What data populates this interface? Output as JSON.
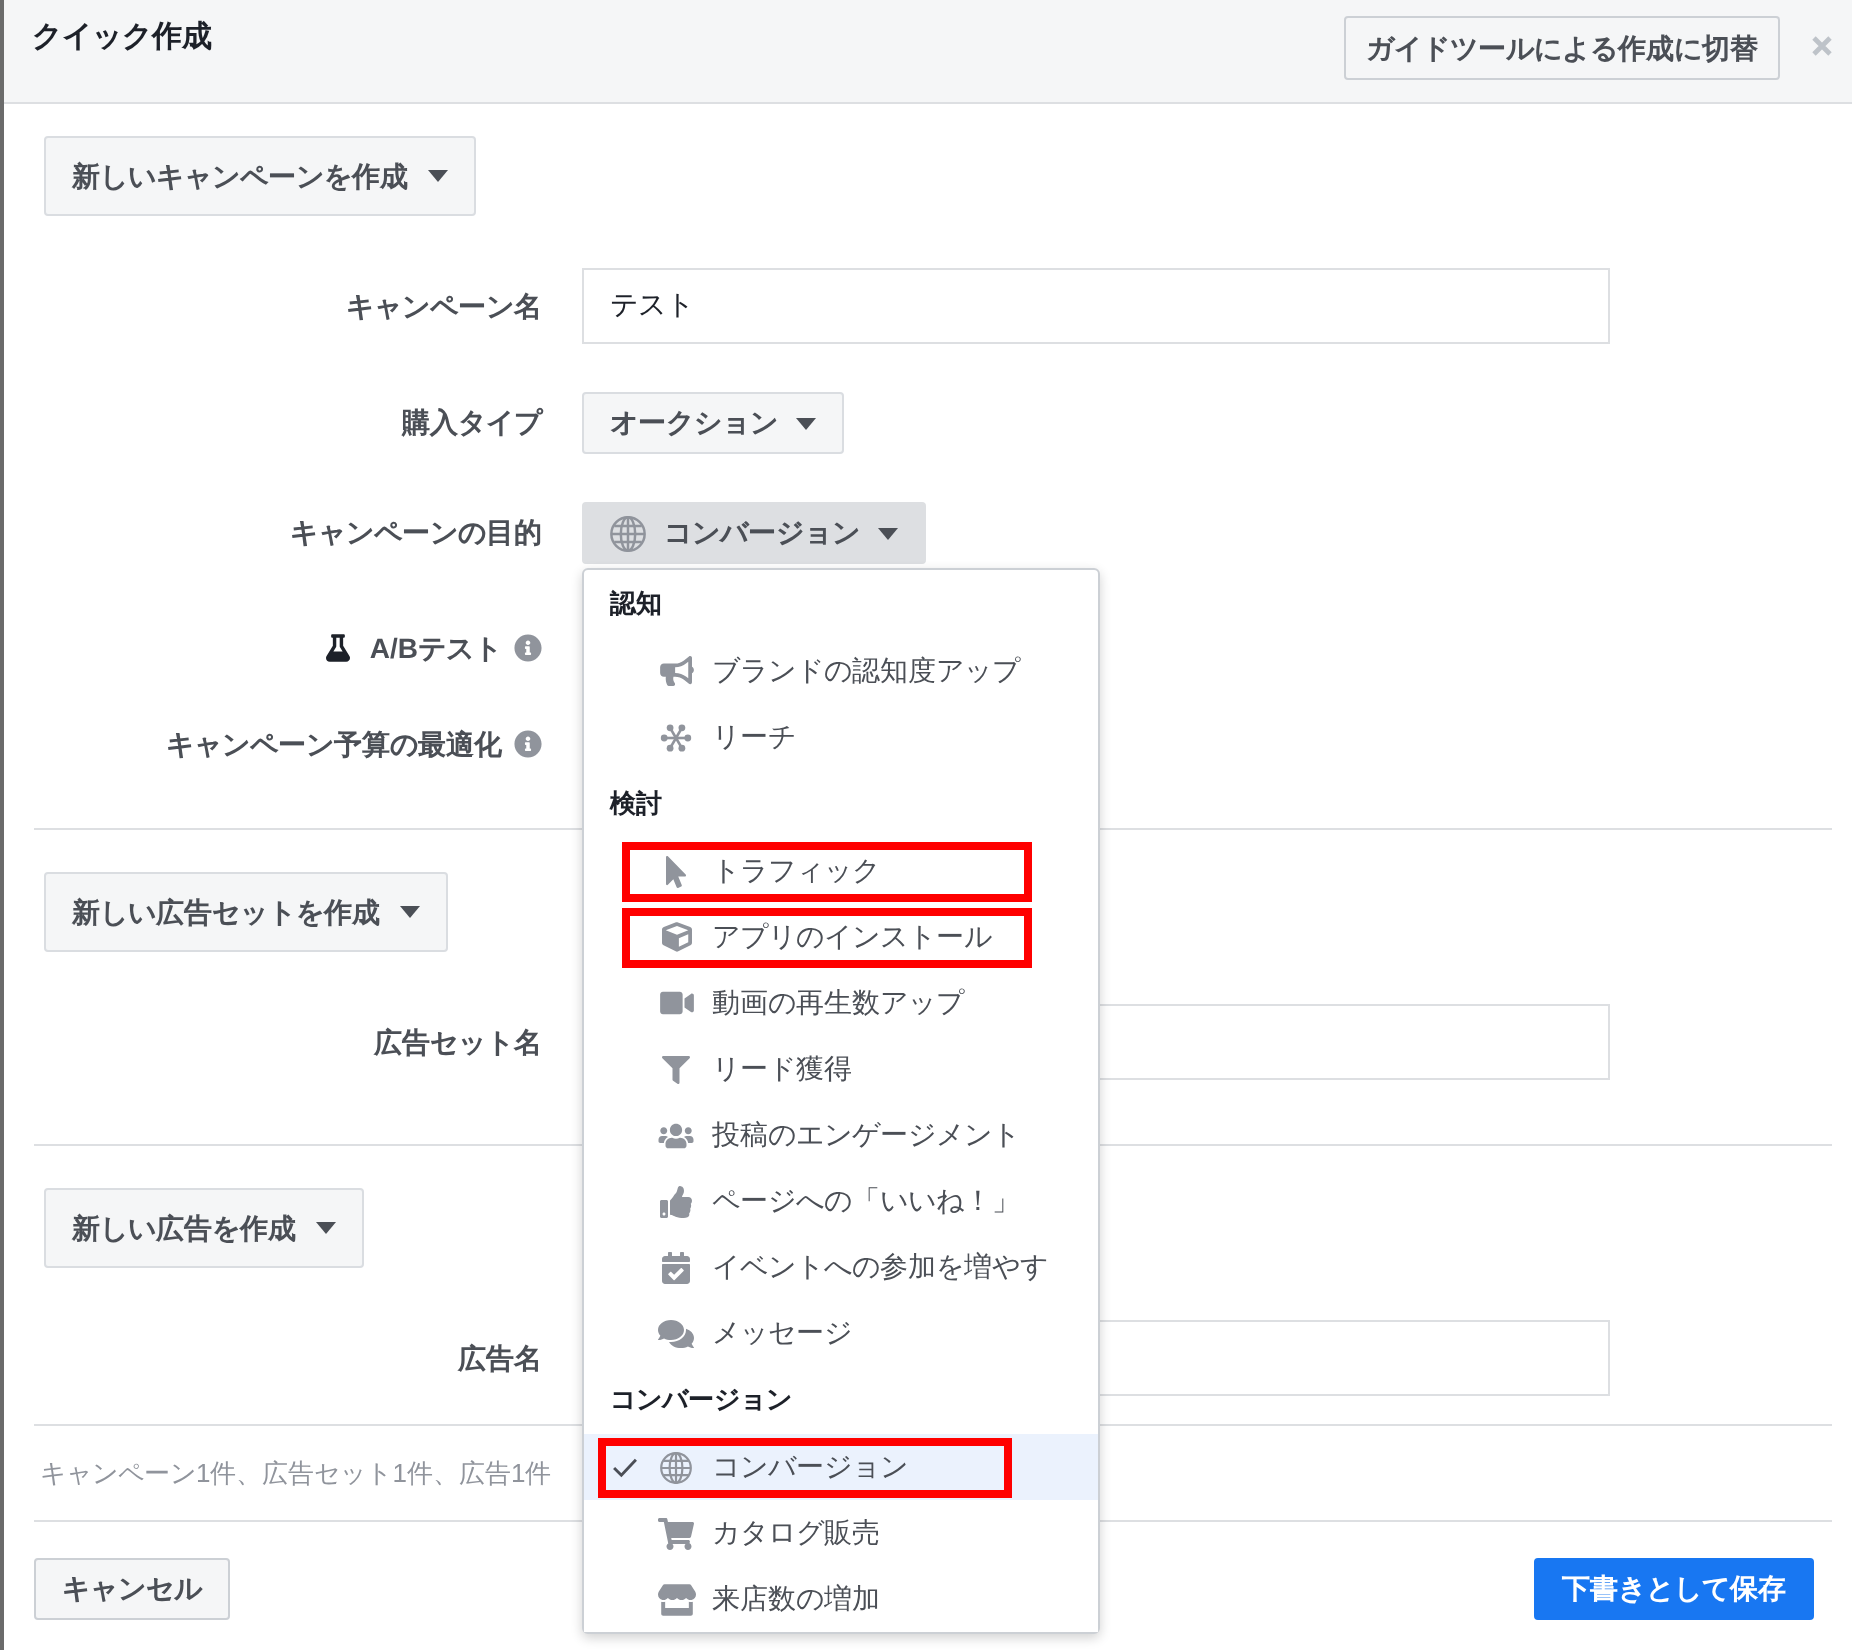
{
  "dialog": {
    "title": "クイック作成",
    "switch_button": "ガイドツールによる作成に切替"
  },
  "sections": [
    {
      "create_button": "新しいキャンペーンを作成",
      "fields": [
        {
          "kind": "input",
          "label": "キャンペーン名",
          "value": "テスト"
        },
        {
          "kind": "select",
          "label": "購入タイプ",
          "value": "オークション",
          "expanded": false
        },
        {
          "kind": "select",
          "label": "キャンペーンの目的",
          "value": "コンバージョン",
          "expanded": true,
          "menu": {
            "groups": [
              {
                "label": "認知",
                "items": [
                  {
                    "kind": "brand",
                    "label": "ブランドの認知度アップ",
                    "selected": false,
                    "highlighted": false
                  },
                  {
                    "kind": "reach",
                    "label": "リーチ",
                    "selected": false,
                    "highlighted": false
                  }
                ]
              },
              {
                "label": "検討",
                "items": [
                  {
                    "kind": "traffic",
                    "label": "トラフィック",
                    "selected": false,
                    "highlighted": true
                  },
                  {
                    "kind": "app",
                    "label": "アプリのインストール",
                    "selected": false,
                    "highlighted": true
                  },
                  {
                    "kind": "video",
                    "label": "動画の再生数アップ",
                    "selected": false,
                    "highlighted": false
                  },
                  {
                    "kind": "lead",
                    "label": "リード獲得",
                    "selected": false,
                    "highlighted": false
                  },
                  {
                    "kind": "engagement",
                    "label": "投稿のエンゲージメント",
                    "selected": false,
                    "highlighted": false
                  },
                  {
                    "kind": "like",
                    "label": "ページへの「いいね！」",
                    "selected": false,
                    "highlighted": false
                  },
                  {
                    "kind": "event",
                    "label": "イベントへの参加を増やす",
                    "selected": false,
                    "highlighted": false
                  },
                  {
                    "kind": "message",
                    "label": "メッセージ",
                    "selected": false,
                    "highlighted": false
                  }
                ]
              },
              {
                "label": "コンバージョン",
                "items": [
                  {
                    "kind": "conversion",
                    "label": "コンバージョン",
                    "selected": true,
                    "highlighted": true
                  },
                  {
                    "kind": "catalog",
                    "label": "カタログ販売",
                    "selected": false,
                    "highlighted": false
                  },
                  {
                    "kind": "store",
                    "label": "来店数の増加",
                    "selected": false,
                    "highlighted": false
                  }
                ]
              }
            ]
          }
        },
        {
          "kind": "test",
          "label": "A/Bテスト"
        },
        {
          "kind": "setting",
          "label": "キャンペーン予算の最適化"
        }
      ]
    },
    {
      "create_button": "新しい広告セットを作成",
      "fields": [
        {
          "kind": "input",
          "label": "広告セット名"
        }
      ]
    },
    {
      "create_button": "新しい広告を作成",
      "fields": [
        {
          "kind": "input",
          "label": "広告名"
        }
      ]
    }
  ],
  "summary": "キャンペーン1件、広告セット1件、広告1件",
  "footer": {
    "cancel": "キャンセル",
    "save": "下書きとして保存"
  }
}
